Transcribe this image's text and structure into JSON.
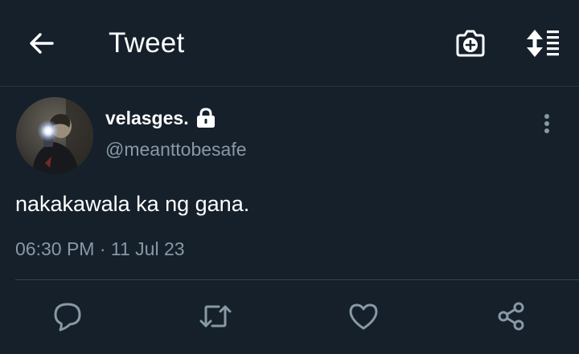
{
  "header": {
    "title": "Tweet",
    "back_icon": "arrow-left-icon",
    "camera_icon": "camera-plus-icon",
    "sort_icon": "sort-thread-icon"
  },
  "tweet": {
    "author_name": "velasges.",
    "author_handle": "@meanttobesafe",
    "protected_icon": "lock-icon",
    "text": "nakakawala ka ng gana.",
    "time": "06:30 PM",
    "separator": "·",
    "date": "11 Jul 23",
    "more_icon": "more-vertical-icon"
  },
  "actions": [
    {
      "name": "reply",
      "icon": "reply-bubble-icon"
    },
    {
      "name": "retweet",
      "icon": "retweet-icon"
    },
    {
      "name": "like",
      "icon": "heart-icon"
    },
    {
      "name": "share",
      "icon": "share-icon"
    }
  ],
  "colors": {
    "background": "#15202b",
    "text_primary": "#ffffff",
    "text_secondary": "#8899a6",
    "divider": "#38444d"
  }
}
